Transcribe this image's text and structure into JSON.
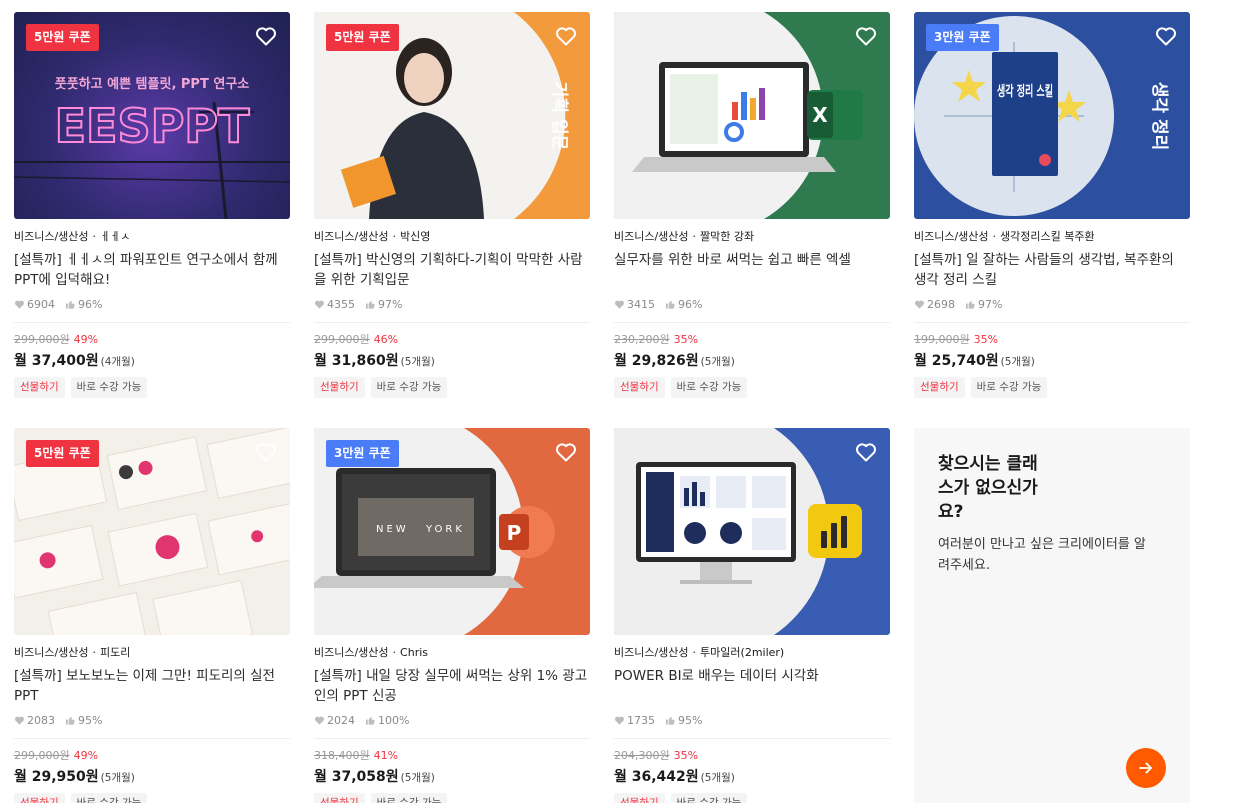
{
  "courses": [
    {
      "coupon": "5만원 쿠폰",
      "category": "비즈니스/생산성",
      "creator": "ㅔㅔㅅ",
      "title": "[설특까] ㅔㅔㅅ의 파워포인트 연구소에서 함께 PPT에 입덕해요!",
      "likes": "6904",
      "rating": "96%",
      "original_price": "299,000원",
      "discount": "49%",
      "monthly": "월 37,400원",
      "installment": "(4개월)",
      "tag_gift": "선물하기",
      "tag_access": "바로 수강 가능",
      "thumb_text_small": "풋풋하고 예쁜 템플릿, PPT 연구소",
      "thumb_text_big": "EESPPT"
    },
    {
      "coupon": "5만원 쿠폰",
      "category": "비즈니스/생산성",
      "creator": "박신영",
      "title": "[설특까] 박신영의 기획하다-기획이 막막한 사람을 위한 기획입문",
      "likes": "4355",
      "rating": "97%",
      "original_price": "299,000원",
      "discount": "46%",
      "monthly": "월 31,860원",
      "installment": "(5개월)",
      "tag_gift": "선물하기",
      "tag_access": "바로 수강 가능",
      "thumb_text": "기획 입문"
    },
    {
      "coupon": "",
      "category": "비즈니스/생산성",
      "creator": "짤막한 강좌",
      "title": "실무자를 위한 바로 써먹는 쉽고 빠른 엑셀",
      "likes": "3415",
      "rating": "96%",
      "original_price": "230,200원",
      "discount": "35%",
      "monthly": "월 29,826원",
      "installment": "(5개월)",
      "tag_gift": "선물하기",
      "tag_access": "바로 수강 가능",
      "thumb_logo": "X"
    },
    {
      "coupon": "3만원 쿠폰",
      "category": "비즈니스/생산성",
      "creator": "생각정리스킬 복주환",
      "title": "[설특까] 일 잘하는 사람들의 생각법, 복주환의 생각 정리 스킬",
      "likes": "2698",
      "rating": "97%",
      "original_price": "199,000원",
      "discount": "35%",
      "monthly": "월 25,740원",
      "installment": "(5개월)",
      "tag_gift": "선물하기",
      "tag_access": "바로 수강 가능",
      "thumb_text": "생각 정리",
      "book_title": "생각 정리 스킬"
    },
    {
      "coupon": "5만원 쿠폰",
      "category": "비즈니스/생산성",
      "creator": "피도리",
      "title": "[설특까] 보노보노는 이제 그만! 피도리의 실전 PPT",
      "likes": "2083",
      "rating": "95%",
      "original_price": "299,000원",
      "discount": "49%",
      "monthly": "월 29,950원",
      "installment": "(5개월)",
      "tag_gift": "선물하기",
      "tag_access": "바로 수강 가능"
    },
    {
      "coupon": "3만원 쿠폰",
      "category": "비즈니스/생산성",
      "creator": "Chris",
      "title": "[설특까] 내일 당장 실무에 써먹는 상위 1% 광고인의 PPT 신공",
      "likes": "2024",
      "rating": "100%",
      "original_price": "318,400원",
      "discount": "41%",
      "monthly": "월 37,058원",
      "installment": "(5개월)",
      "tag_gift": "선물하기",
      "tag_access": "바로 수강 가능",
      "screen_text_1": "NEW",
      "screen_text_2": "YORK",
      "thumb_logo": "P"
    },
    {
      "coupon": "",
      "category": "비즈니스/생산성",
      "creator": "투마일러(2miler)",
      "title": "POWER BI로 배우는 데이터 시각화",
      "likes": "1735",
      "rating": "95%",
      "original_price": "204,300원",
      "discount": "35%",
      "monthly": "월 36,442원",
      "installment": "(5개월)",
      "tag_gift": "선물하기",
      "tag_access": "바로 수강 가능"
    }
  ],
  "request_card": {
    "title": "찾으시는 클래스가 없으신가요?",
    "description": "여러분이 만나고 싶은 크리에이터를 알려주세요."
  },
  "colors": {
    "accent_red": "#ef3340",
    "coupon_blue": "#4a7cf7",
    "cta_orange": "#ff5a00"
  },
  "icons": [
    "heart-icon",
    "like-heart-icon",
    "thumbs-up-icon",
    "arrow-right-icon"
  ]
}
